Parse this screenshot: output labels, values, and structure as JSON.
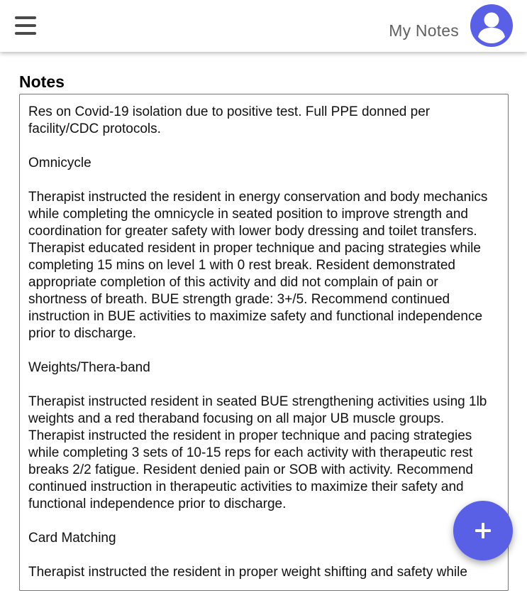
{
  "header": {
    "title": "My Notes",
    "menu_icon": "hamburger-menu-icon",
    "avatar_icon": "account-circle-icon"
  },
  "notes": {
    "label": "Notes",
    "text": "Res on Covid-19 isolation due to positive test. Full PPE donned per facility/CDC protocols.\n\nOmnicycle\n\nTherapist instructed the resident in energy conservation and body mechanics while completing the omnicycle in seated position to improve strength and coordination for greater safety with lower body dressing and toilet transfers. Therapist educated resident in proper technique and pacing strategies while completing 15 mins on level 1 with 0 rest break. Resident demonstrated appropriate completion of this activity and did not complain of pain or shortness of breath. BUE strength grade: 3+/5. Recommend continued instruction in BUE activities to maximize safety and functional independence prior to discharge.\n\nWeights/Thera-band\n\nTherapist instructed resident in seated BUE strengthening activities using 1lb weights and a red theraband focusing on all major UB muscle groups. Therapist instructed the resident in proper technique and pacing strategies while completing 3 sets of 10-15 reps for each activity with therapeutic rest breaks 2/2 fatigue. Resident denied pain or SOB with activity. Recommend continued instruction in therapeutic activities to maximize their safety and functional independence prior to discharge.\n\nCard Matching\n\nTherapist instructed the resident in proper weight shifting and safety while"
  },
  "fab": {
    "icon": "plus-icon"
  },
  "colors": {
    "accent": "#5960e6",
    "title_text": "#616161",
    "menu_icon": "#4a4a4a"
  }
}
